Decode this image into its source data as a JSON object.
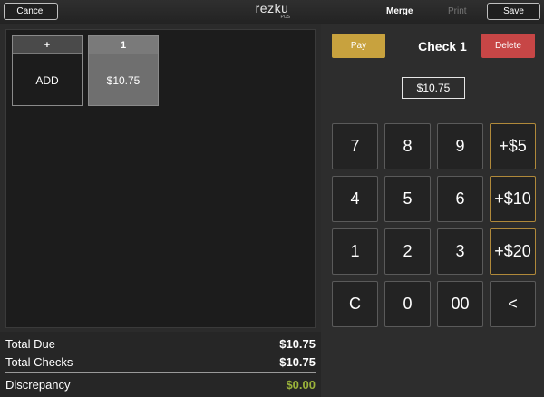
{
  "topbar": {
    "cancel_label": "Cancel",
    "logo_text": "rezku",
    "logo_sub": "POS",
    "merge_label": "Merge",
    "print_label": "Print",
    "save_label": "Save"
  },
  "tiles": {
    "add": {
      "header": "+",
      "body": "ADD"
    },
    "check1": {
      "header": "1",
      "body": "$10.75"
    }
  },
  "totals": {
    "total_due_label": "Total Due",
    "total_due_value": "$10.75",
    "total_checks_label": "Total Checks",
    "total_checks_value": "$10.75",
    "discrepancy_label": "Discrepancy",
    "discrepancy_value": "$0.00"
  },
  "check": {
    "pay_label": "Pay",
    "title": "Check 1",
    "delete_label": "Delete",
    "amount": "$10.75"
  },
  "keypad": {
    "k7": "7",
    "k8": "8",
    "k9": "9",
    "q5": "+$5",
    "k4": "4",
    "k5": "5",
    "k6": "6",
    "q10": "+$10",
    "k1": "1",
    "k2": "2",
    "k3": "3",
    "q20": "+$20",
    "clear": "C",
    "k0": "0",
    "k00": "00",
    "back": "<"
  },
  "colors": {
    "pay": "#c8a23e",
    "delete": "#c74646",
    "discrepancy": "#9bb33a"
  }
}
